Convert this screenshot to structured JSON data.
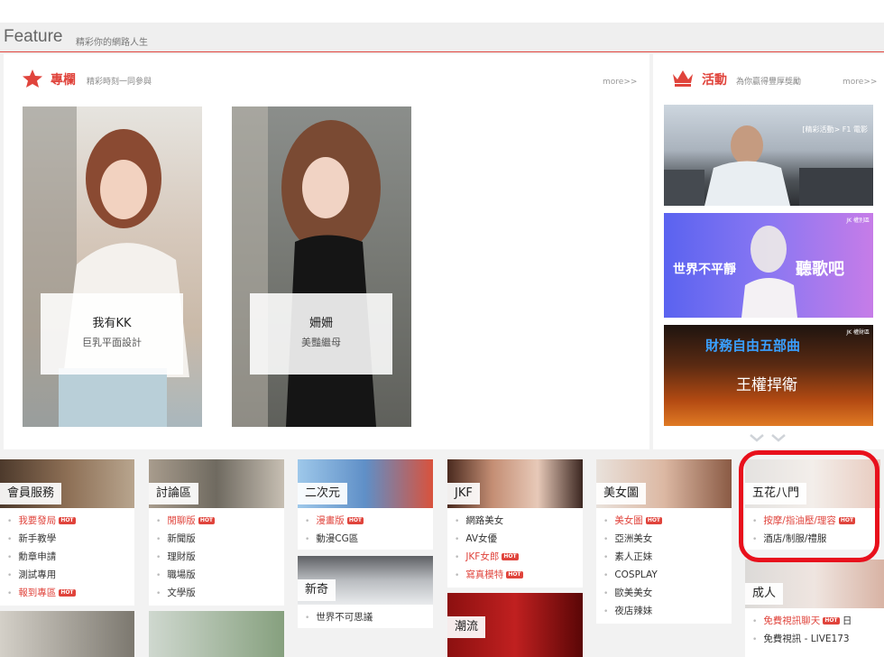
{
  "feature": {
    "title": "Feature",
    "subtitle": "精彩你的網路人生"
  },
  "column": {
    "title": "專欄",
    "subtitle": "精彩時刻一同參與",
    "more": "more>>",
    "cards": [
      {
        "name": "我有KK",
        "desc": "巨乳平面設計"
      },
      {
        "name": "姍姍",
        "desc": "美豔繼母"
      }
    ]
  },
  "event": {
    "title": "活動",
    "subtitle": "為你贏得豐厚獎勵",
    "more": "more>>",
    "banners": [
      {
        "caption": "[精彩活動> F1 電影"
      },
      {
        "tag": "JK 權別區",
        "left": "世界不平靜",
        "right": "聽歌吧"
      },
      {
        "tag": "JK 權財區",
        "top": "財務自由五部曲",
        "mid": "王權捍衛"
      }
    ]
  },
  "categories": [
    {
      "label": "會員服務",
      "items": [
        {
          "text": "我要發局",
          "hot": "HOT",
          "red": true
        },
        {
          "text": "新手教學"
        },
        {
          "text": "勳章申請"
        },
        {
          "text": "測試專用"
        },
        {
          "text": "報到專區",
          "hot": "HOT",
          "red": true
        }
      ]
    },
    {
      "label": "討論區",
      "items": [
        {
          "text": "閒聊版",
          "hot": "HOT",
          "red": true
        },
        {
          "text": "新聞版"
        },
        {
          "text": "理財版"
        },
        {
          "text": "職場版"
        },
        {
          "text": "文學版"
        }
      ]
    },
    {
      "label": "二次元",
      "items": [
        {
          "text": "漫畫版",
          "hot": "HOT",
          "red": true
        },
        {
          "text": "動漫CG區"
        }
      ]
    },
    {
      "label": "新奇",
      "items": [
        {
          "text": "世界不可思議"
        }
      ]
    },
    {
      "label": "JKF",
      "items": [
        {
          "text": "網路美女"
        },
        {
          "text": "AV女優"
        },
        {
          "text": "JKF女郎",
          "hot": "HOT",
          "red": true
        },
        {
          "text": "寫真模特",
          "hot": "HOT",
          "red": true
        }
      ]
    },
    {
      "label": "潮流",
      "items": []
    },
    {
      "label": "美女圖",
      "items": [
        {
          "text": "美女圖",
          "hot": "HOT",
          "red": true
        },
        {
          "text": "亞洲美女"
        },
        {
          "text": "素人正妹"
        },
        {
          "text": "COSPLAY"
        },
        {
          "text": "歐美美女"
        },
        {
          "text": "夜店辣妹"
        }
      ]
    },
    {
      "label": "五花八門",
      "items": [
        {
          "text": "按摩/指油壓/理容",
          "hot": "HOT",
          "red": true
        },
        {
          "text": "酒店/制服/禮服"
        }
      ]
    },
    {
      "label": "成人",
      "items": [
        {
          "text": "免費視訊聊天",
          "hot": "HOT",
          "red": true,
          "suffix": "日"
        },
        {
          "text": "免費視訊 - LIVE173"
        }
      ]
    }
  ],
  "colors": {
    "accent": "#e0443c",
    "highlight": "#e8101c"
  }
}
